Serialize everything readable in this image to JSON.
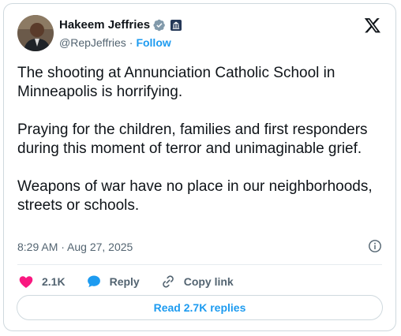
{
  "author": {
    "name": "Hakeem Jeffries",
    "handle": "@RepJeffries",
    "follow_label": "Follow"
  },
  "tweet": {
    "text": "The shooting at Annunciation Catholic School in Minneapolis is horrifying.\n\nPraying for the children, families and first responders during this moment of terror and unimaginable grief.\n\nWeapons of war have no place in our neighborhoods, streets or schools.",
    "timestamp": "8:29 AM · Aug 27, 2025"
  },
  "actions": {
    "likes_count": "2.1K",
    "reply_label": "Reply",
    "copy_link_label": "Copy link"
  },
  "read_replies_label": "Read 2.7K replies",
  "icons": {
    "verified": "verified-badge-icon",
    "government": "government-badge-icon",
    "logo": "x-logo-icon",
    "info": "info-icon",
    "like": "heart-icon",
    "reply": "reply-bubble-icon",
    "link": "link-icon"
  },
  "colors": {
    "accent": "#1d9bf0",
    "like": "#f91880",
    "text": "#0f1419",
    "muted": "#536471",
    "border": "#cfd9de"
  }
}
